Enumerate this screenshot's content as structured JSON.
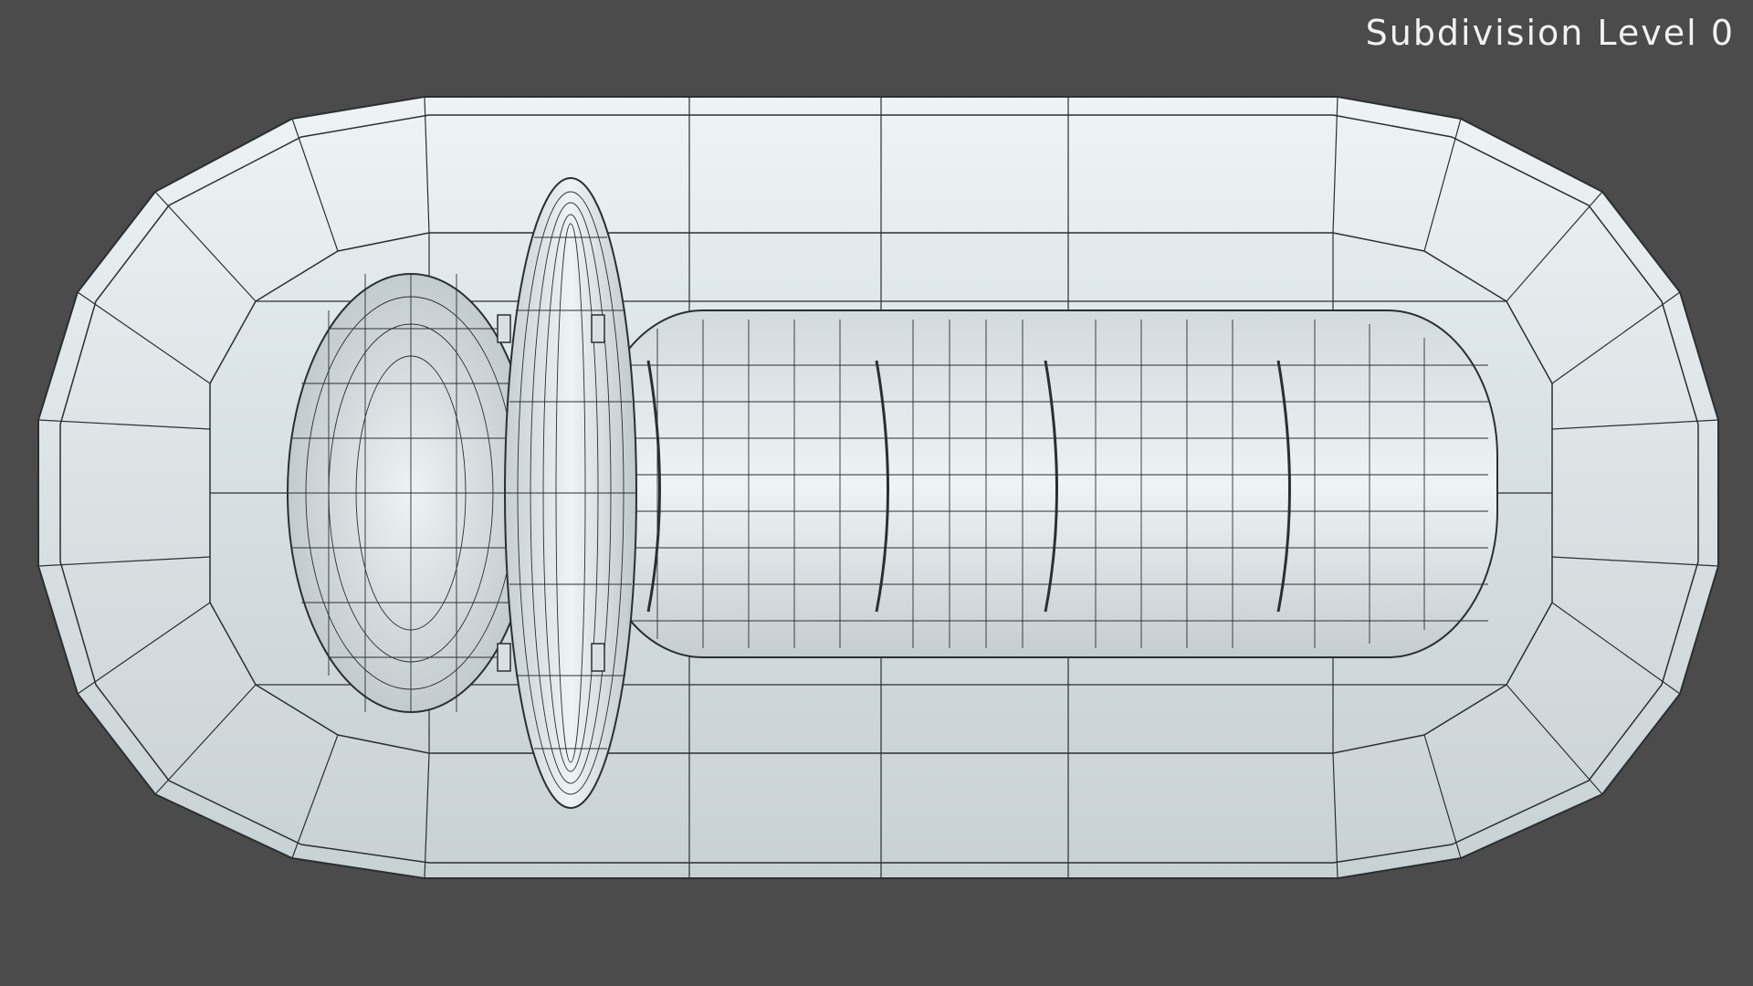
{
  "viewport": {
    "overlay_label": "Subdivision Level 0",
    "background_color": "#4b4b4b",
    "mesh_color": "#dce4e6",
    "wire_color": "#2a2f32"
  },
  "scene": {
    "objects": [
      "tray-mesh",
      "knob-mesh",
      "ring-mesh",
      "grip-mesh"
    ],
    "wireframe": true
  }
}
